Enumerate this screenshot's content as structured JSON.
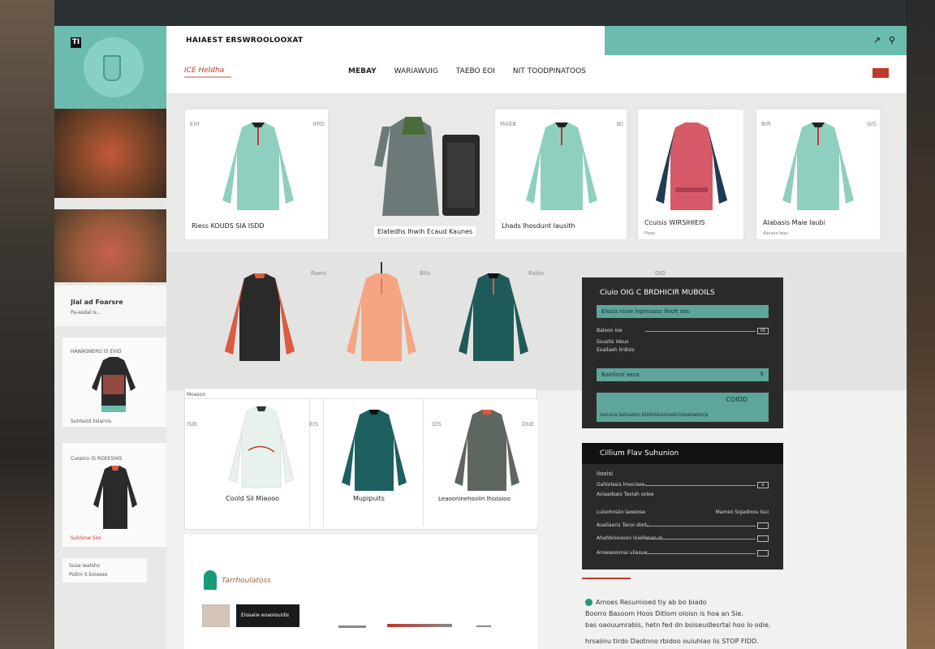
{
  "app": {
    "title": "HAIAEST ERSWROOLOOXAT",
    "logo_mark": "TI",
    "top_icons": [
      "↗",
      "⚲"
    ]
  },
  "nav": {
    "brand": "ICE Heldha",
    "items": [
      "MEBAY",
      "WARIAWUIG",
      "TAEBO EOI",
      "NIT TOODPINATOOS"
    ],
    "active_index": 0
  },
  "left": {
    "info_title": "Jlal ad Foarsre",
    "info_sub": "Pa-esdal Is...",
    "card1_label": "HAWASNERO IS EVID",
    "card1_caption": "Suhlsoid Iislarnis",
    "card2_label": "Cuosicn IS ROEESHIS",
    "card2_caption": "Suhlsnw Soo",
    "card3_label": "Susa Iaatshs",
    "card3_caption": "Poltm S boieses"
  },
  "row1": {
    "cards": [
      {
        "tag": "EIH",
        "tag2": "IIRD",
        "label": "Riess KOUDS SIA ISDD",
        "color": "#8fcfc0",
        "accent": "#222"
      },
      {
        "tag": "",
        "tag2": "",
        "label": "Elatedhs Ihwih Ecaud Kaunes",
        "color": "#6b7a78",
        "accent": "#4a6b3a"
      },
      {
        "tag": "MAEB",
        "tag2": "IEI",
        "label": "Lhads Ihosdunt Iausith",
        "color": "#8fcfc0",
        "accent": "#222"
      },
      {
        "tag": "",
        "tag2": "",
        "label": "Ccuisis WIRSIHIEIS",
        "sub": "Flees",
        "color": "#d65a68",
        "accent": "#1f3b55"
      },
      {
        "tag": "BIR",
        "tag2": "GIS",
        "label": "Alabasis Maie Iaubi",
        "sub": "Aieuoio Ieau",
        "color": "#8fcfc0",
        "accent": "#222"
      }
    ]
  },
  "row2": {
    "tags": [
      "Raeis",
      "Blts",
      "Rabis",
      "DIO"
    ],
    "shirts": [
      {
        "color": "#2a2a2a",
        "accent": "#e05a3e"
      },
      {
        "color": "#f5a582",
        "accent": "#e07a5e"
      },
      {
        "color": "#1f5a5a",
        "accent": "#e05a3e"
      }
    ]
  },
  "row3": {
    "header": "Moasoo",
    "tags": [
      "ISIE",
      "EIS",
      "IDS",
      "DUE"
    ],
    "cards": [
      {
        "label": "Coold Sil Miaooo",
        "color": "#e8f2ec",
        "accent": "#c0392b"
      },
      {
        "label": "Mupipuits",
        "color": "#1e5f5f",
        "accent": "#111"
      },
      {
        "label": "Leaooninehoolin lhsoaioo",
        "color": "#5e6660",
        "accent": "#e05a3e"
      }
    ]
  },
  "panel1": {
    "title": "Ciuio OIG C BRDHICIR MUBOILS",
    "bar1": "Elssia niuie lnpinaaso lhiolt Isis",
    "row1_label": "Baloon ioe",
    "row1_value": "IIS",
    "row2_label": "Soustis ideus",
    "row2_label2": "Eoailaeh lirdisis",
    "bar2": "Bairiioni seus",
    "bar2_value": "$",
    "bar3_value": "COIDD",
    "bar3_label": "Isoiuoa lsoluidoo biidoloisioiuelicisioelseloirp"
  },
  "panel2": {
    "title": "Cillium Flav Suhunion",
    "subtitle": "Iiooisi",
    "rows": [
      {
        "label": "Gahiolasis lmecisee-",
        "value": "e"
      },
      {
        "label": "Aviaadsais Taoiah soiee",
        "value": ""
      },
      {
        "label": "Luisohnsiio laoeiose",
        "value": "Mamioi Sigadioou lsui"
      },
      {
        "label": "Aualiaeris Tanoi sbot-",
        "value": ""
      },
      {
        "label": "Ahahbnioooon loielleoao ol",
        "value": ""
      },
      {
        "label": "Arowaooimai uliasue",
        "value": ""
      }
    ]
  },
  "bottom": {
    "brand_text": "Tarrhoulatoss",
    "dark_button": "Eiosaiie eoaoiouidis",
    "line1": "Amoes Resumioed tiy ab bo biado",
    "line2": "Boorro Basoom Hoos Ditlom oloisn is hoa an Sie.",
    "line3": "bas oaouumrabis, hetn fed dn boiseudlesrtal hoo lo odie.",
    "line4": "hrsaiinu  tirdo Daotnno rbidoo ouiuhiao lis STOP FIDD."
  },
  "colors": {
    "teal": "#6bbcae",
    "accent_red": "#c0392b",
    "dark_panel": "#2a2a2a"
  }
}
